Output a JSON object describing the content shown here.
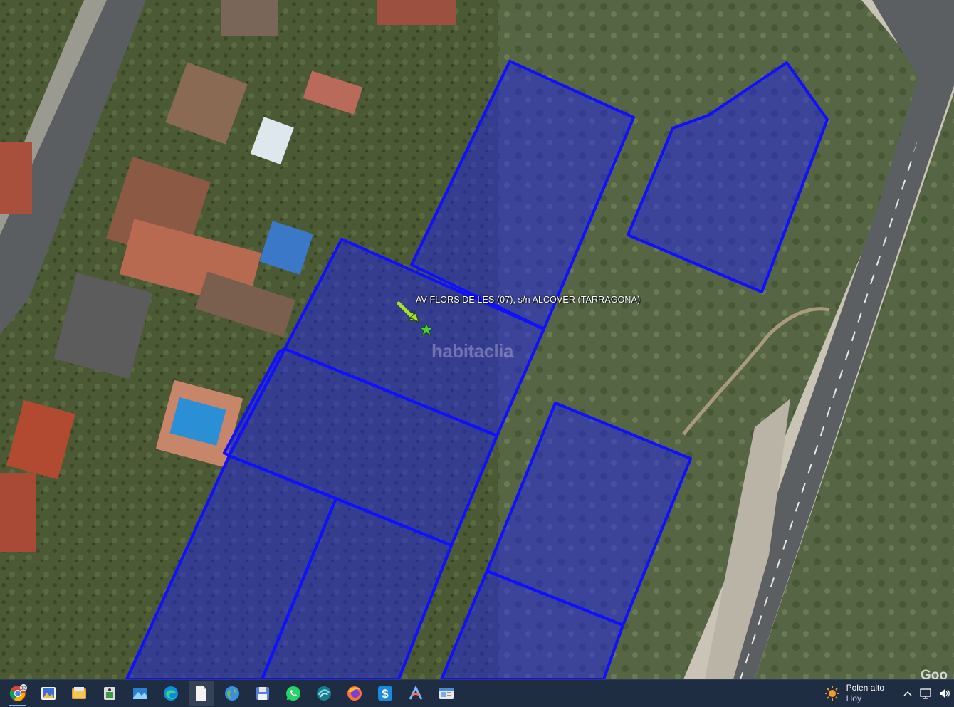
{
  "map": {
    "placemark_label": "AV FLORS DE LES (07), s/n ALCOVER (TARRAGONA)",
    "watermark": "habitaclia",
    "google_mark": "Goo",
    "parcel_color": "#1a1aff"
  },
  "taskbar": {
    "chrome_badge": "12",
    "icons": [
      "chrome-icon",
      "photos-icon",
      "file-explorer-icon",
      "app-icon",
      "gallery-icon",
      "edge-icon",
      "document-icon",
      "globe-icon",
      "floppy-save-icon",
      "whatsapp-icon",
      "wave-app-icon",
      "firefox-icon",
      "s-app-icon",
      "arc-app-icon",
      "window-app-icon"
    ],
    "weather": {
      "line1": "Polen alto",
      "line2": "Hoy"
    }
  }
}
